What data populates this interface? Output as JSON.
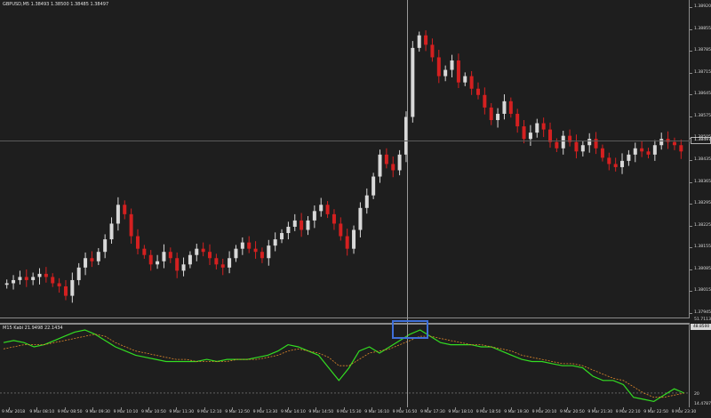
{
  "chart_header": {
    "symbol_line": "GBPUSD,M5  1.38493  1.38500  1.38485  1.38497"
  },
  "indicator_header": {
    "label": "M15 Kabi  21.9498  22.1434"
  },
  "price_axis": {
    "ticks": [
      "1.38920",
      "1.38855",
      "1.38785",
      "1.38715",
      "1.38645",
      "1.38575",
      "1.38505",
      "1.38435",
      "1.38365",
      "1.38295",
      "1.38225",
      "1.38155",
      "1.38085",
      "1.38015",
      "1.37945"
    ],
    "current_price": "1.38497"
  },
  "indicator_axis": {
    "ticks": [
      "51.7113",
      "48.8500",
      "20",
      "14.4787"
    ]
  },
  "time_axis": {
    "labels": [
      "9 Mar 2018",
      "9 Mar 08:10",
      "9 Mar 08:50",
      "9 Mar 09:30",
      "9 Mar 10:10",
      "9 Mar 10:50",
      "9 Mar 11:30",
      "9 Mar 12:10",
      "9 Mar 12:50",
      "9 Mar 13:30",
      "9 Mar 14:10",
      "9 Mar 14:50",
      "9 Mar 15:30",
      "9 Mar 16:10",
      "9 Mar 16:50",
      "9 Mar 17:30",
      "9 Mar 18:10",
      "9 Mar 18:50",
      "9 Mar 19:30",
      "9 Mar 20:10",
      "9 Mar 20:50",
      "9 Mar 21:30",
      "9 Mar 22:10",
      "9 Mar 22:50",
      "9 Mar 23:30"
    ]
  },
  "colors": {
    "background": "#1e1e1e",
    "bull_candle": "#d8d8d8",
    "bear_candle": "#d42020",
    "indicator_main": "#33dd22",
    "indicator_signal": "#e0882a",
    "highlight": "#3f6fd8"
  },
  "chart_data": [
    {
      "type": "candlestick",
      "symbol": "GBPUSD",
      "timeframe": "M5",
      "ylim": [
        1.37945,
        1.3892
      ],
      "close_series": [
        1.3804,
        1.3805,
        1.3806,
        1.3805,
        1.3806,
        1.3807,
        1.3806,
        1.3804,
        1.3803,
        1.38,
        1.3805,
        1.3809,
        1.3812,
        1.3811,
        1.3814,
        1.3818,
        1.3823,
        1.3829,
        1.3826,
        1.3819,
        1.3815,
        1.3813,
        1.381,
        1.3811,
        1.3814,
        1.3812,
        1.3808,
        1.381,
        1.3813,
        1.3815,
        1.3814,
        1.3812,
        1.381,
        1.3809,
        1.3812,
        1.3815,
        1.3817,
        1.3815,
        1.3814,
        1.3812,
        1.3816,
        1.3818,
        1.382,
        1.3822,
        1.3824,
        1.3821,
        1.3824,
        1.3827,
        1.3829,
        1.3826,
        1.3823,
        1.3819,
        1.3815,
        1.3821,
        1.3828,
        1.3832,
        1.3838,
        1.3845,
        1.3842,
        1.384,
        1.3845,
        1.3857,
        1.3879,
        1.3883,
        1.388,
        1.3876,
        1.387,
        1.3872,
        1.3875,
        1.3868,
        1.387,
        1.3866,
        1.3864,
        1.386,
        1.3856,
        1.3858,
        1.3862,
        1.3858,
        1.3854,
        1.385,
        1.3852,
        1.3855,
        1.3853,
        1.3849,
        1.3847,
        1.3851,
        1.3849,
        1.3846,
        1.3848,
        1.385,
        1.3847,
        1.3844,
        1.3842,
        1.3841,
        1.3843,
        1.3845,
        1.3847,
        1.3846,
        1.3845,
        1.3848,
        1.385,
        1.3849,
        1.3848,
        1.3846
      ]
    },
    {
      "type": "line",
      "name": "M15 Kabi",
      "ylim": [
        14.4787,
        51.7113
      ],
      "series": [
        {
          "values": [
            44,
            45,
            44,
            42,
            43,
            45,
            47,
            49,
            50,
            48,
            45,
            42,
            40,
            38,
            37,
            36,
            35,
            35,
            35,
            35,
            36,
            35,
            36,
            36,
            36,
            37,
            38,
            40,
            43,
            42,
            40,
            38,
            32,
            26,
            32,
            40,
            42,
            39,
            42,
            45,
            48,
            50,
            47,
            44,
            43,
            43,
            43,
            42,
            42,
            40,
            38,
            36,
            35,
            35,
            34,
            33,
            33,
            32,
            28,
            26,
            26,
            24,
            18,
            17,
            16,
            19,
            22,
            20
          ]
        },
        {
          "values": [
            41,
            42,
            43,
            43,
            43,
            44,
            45,
            46,
            47,
            48,
            47,
            44,
            42,
            40,
            39,
            38,
            37,
            36,
            36,
            35,
            35,
            35,
            35,
            36,
            36,
            36,
            37,
            38,
            40,
            41,
            40,
            39,
            37,
            33,
            33,
            36,
            39,
            40,
            41,
            43,
            45,
            47,
            47,
            46,
            45,
            44,
            43,
            43,
            42,
            41,
            40,
            38,
            37,
            36,
            35,
            34,
            34,
            33,
            31,
            29,
            27,
            26,
            23,
            20,
            18,
            18,
            19,
            20
          ]
        }
      ]
    }
  ]
}
